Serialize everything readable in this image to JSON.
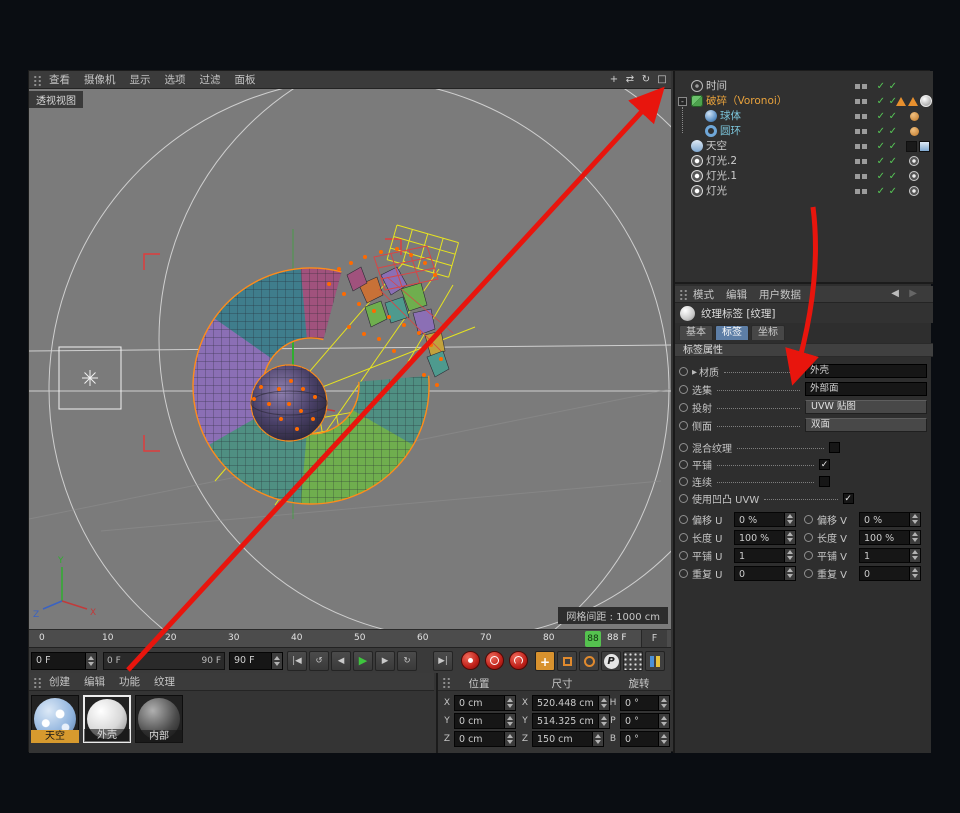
{
  "viewport": {
    "menu": [
      "查看",
      "摄像机",
      "显示",
      "选项",
      "过滤",
      "面板"
    ],
    "view_label": "透视视图",
    "grid_label": "网格间距 : 1000 cm",
    "axis": {
      "x": "X",
      "y": "Y",
      "z": "Z"
    }
  },
  "object_manager": {
    "items": [
      {
        "label": "时间",
        "type": "time"
      },
      {
        "label": "破碎（Voronoi）",
        "type": "voronoi-fracture",
        "selected": true
      },
      {
        "label": "球体",
        "type": "sphere"
      },
      {
        "label": "圆环",
        "type": "torus"
      },
      {
        "label": "天空",
        "type": "sky"
      },
      {
        "label": "灯光.2",
        "type": "light"
      },
      {
        "label": "灯光.1",
        "type": "light"
      },
      {
        "label": "灯光",
        "type": "light"
      }
    ]
  },
  "attribute_manager": {
    "menu": [
      "模式",
      "编辑",
      "用户数据"
    ],
    "title": "纹理标签 [纹理]",
    "tabs": [
      "基本",
      "标签",
      "坐标"
    ],
    "active_tab": "标签",
    "section": "标签属性",
    "fields": [
      {
        "label": "材质",
        "value": "外壳"
      },
      {
        "label": "选集",
        "value": "外部面"
      },
      {
        "label": "投射",
        "value": "UVW 贴图"
      },
      {
        "label": "侧面",
        "value": "双面"
      }
    ],
    "checks": [
      {
        "label": "混合纹理",
        "mark": ""
      },
      {
        "label": "平铺",
        "mark": "✓"
      },
      {
        "label": "连续",
        "mark": ""
      },
      {
        "label": "使用凹凸 UVW",
        "mark": "✓"
      }
    ],
    "uv_rows": [
      {
        "l1": "偏移 U",
        "v1": "0 %",
        "l2": "偏移 V",
        "v2": "0 %"
      },
      {
        "l1": "长度 U",
        "v1": "100 %",
        "l2": "长度 V",
        "v2": "100 %"
      },
      {
        "l1": "平铺 U",
        "v1": "1",
        "l2": "平铺 V",
        "v2": "1"
      },
      {
        "l1": "重复 U",
        "v1": "0",
        "l2": "重复 V",
        "v2": "0"
      }
    ]
  },
  "timeline": {
    "ticks": [
      "0",
      "10",
      "20",
      "30",
      "40",
      "50",
      "60",
      "70",
      "80"
    ],
    "playhead": "88",
    "playhead_label": "88 F",
    "frame_unit": "F",
    "current_frame": "0 F",
    "range_start": "0 F",
    "range_end": "90 F",
    "end_frame": "90 F"
  },
  "transport": {
    "p_label": "P"
  },
  "material_manager": {
    "menu": [
      "创建",
      "编辑",
      "功能",
      "纹理"
    ],
    "items": [
      {
        "label": "天空",
        "highlighted": true
      },
      {
        "label": "外壳",
        "selected": true
      },
      {
        "label": "内部"
      }
    ]
  },
  "coordinate_manager": {
    "headers": [
      "位置",
      "尺寸",
      "旋转"
    ],
    "rows": [
      {
        "pl": "X",
        "pv": "0 cm",
        "sl": "X",
        "sv": "520.448 cm",
        "rl": "H",
        "rv": "0 °"
      },
      {
        "pl": "Y",
        "pv": "0 cm",
        "sl": "Y",
        "sv": "514.325 cm",
        "rl": "P",
        "rv": "0 °"
      },
      {
        "pl": "Z",
        "pv": "0 cm",
        "sl": "Z",
        "sv": "150 cm",
        "rl": "B",
        "rv": "0 °"
      }
    ]
  },
  "colors": {
    "accent_orange": "#ff8c1a",
    "selected_text": "#e8a23c",
    "child_text": "#7cc6dc",
    "check_green": "#56c556",
    "arrow_red": "#e8150d"
  }
}
